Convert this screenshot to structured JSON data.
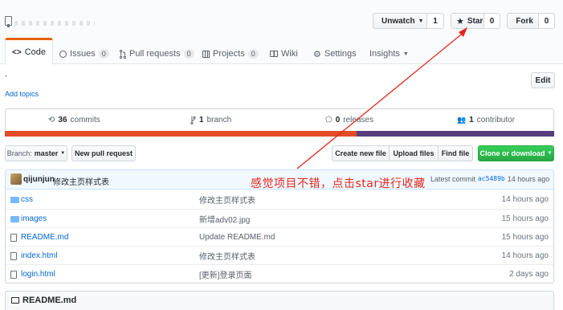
{
  "header": {
    "actions": {
      "watch_label": "Unwatch",
      "watch_count": "1",
      "star_label": "Star",
      "star_count": "0",
      "fork_label": "Fork",
      "fork_count": "0"
    },
    "tabs": [
      {
        "label": "Code",
        "icon": "code-icon"
      },
      {
        "label": "Issues",
        "icon": "issue-icon",
        "count": "0"
      },
      {
        "label": "Pull requests",
        "icon": "pull-request-icon",
        "count": "0"
      },
      {
        "label": "Projects",
        "icon": "project-icon",
        "count": "0"
      },
      {
        "label": "Wiki",
        "icon": "book-icon"
      },
      {
        "label": "Settings",
        "icon": "gear-icon"
      },
      {
        "label": "Insights",
        "icon": "chevron-down-icon"
      }
    ]
  },
  "description": {
    "text": ".",
    "add_topics": "Add topics",
    "edit_label": "Edit"
  },
  "summary": {
    "commits_count": "36",
    "commits_label": "commits",
    "branch_count": "1",
    "branch_label": "branch",
    "releases_count": "0",
    "releases_label": "releases",
    "contributors_count": "1",
    "contributors_label": "contributor",
    "language_colors": [
      "#e34c26",
      "#563d7c"
    ]
  },
  "file_nav": {
    "branch_prefix": "Branch:",
    "branch_name": "master",
    "new_pr": "New pull request",
    "create_file": "Create new file",
    "upload_files": "Upload files",
    "find_file": "Find file",
    "clone": "Clone or download"
  },
  "commit": {
    "author": "qijunjun",
    "message": "修改主页样式表",
    "latest_prefix": "Latest commit",
    "sha": "ac5489b",
    "age": "14 hours ago"
  },
  "files": [
    {
      "name": "css",
      "type": "folder",
      "message": "修改主页样式表",
      "age": "14 hours ago"
    },
    {
      "name": "images",
      "type": "folder",
      "message": "新增adv02.jpg",
      "age": "15 hours ago"
    },
    {
      "name": "README.md",
      "type": "file",
      "message": "Update README.md",
      "age": "15 hours ago"
    },
    {
      "name": "index.html",
      "type": "file",
      "message": "修改主页样式表",
      "age": "14 hours ago"
    },
    {
      "name": "login.html",
      "type": "file",
      "message": "[更新]登录页面",
      "age": "2 days ago"
    }
  ],
  "readme": {
    "title": "README.md"
  },
  "annotation": {
    "text": "感觉项目不错，点击star进行收藏",
    "color": "#e0291e"
  }
}
